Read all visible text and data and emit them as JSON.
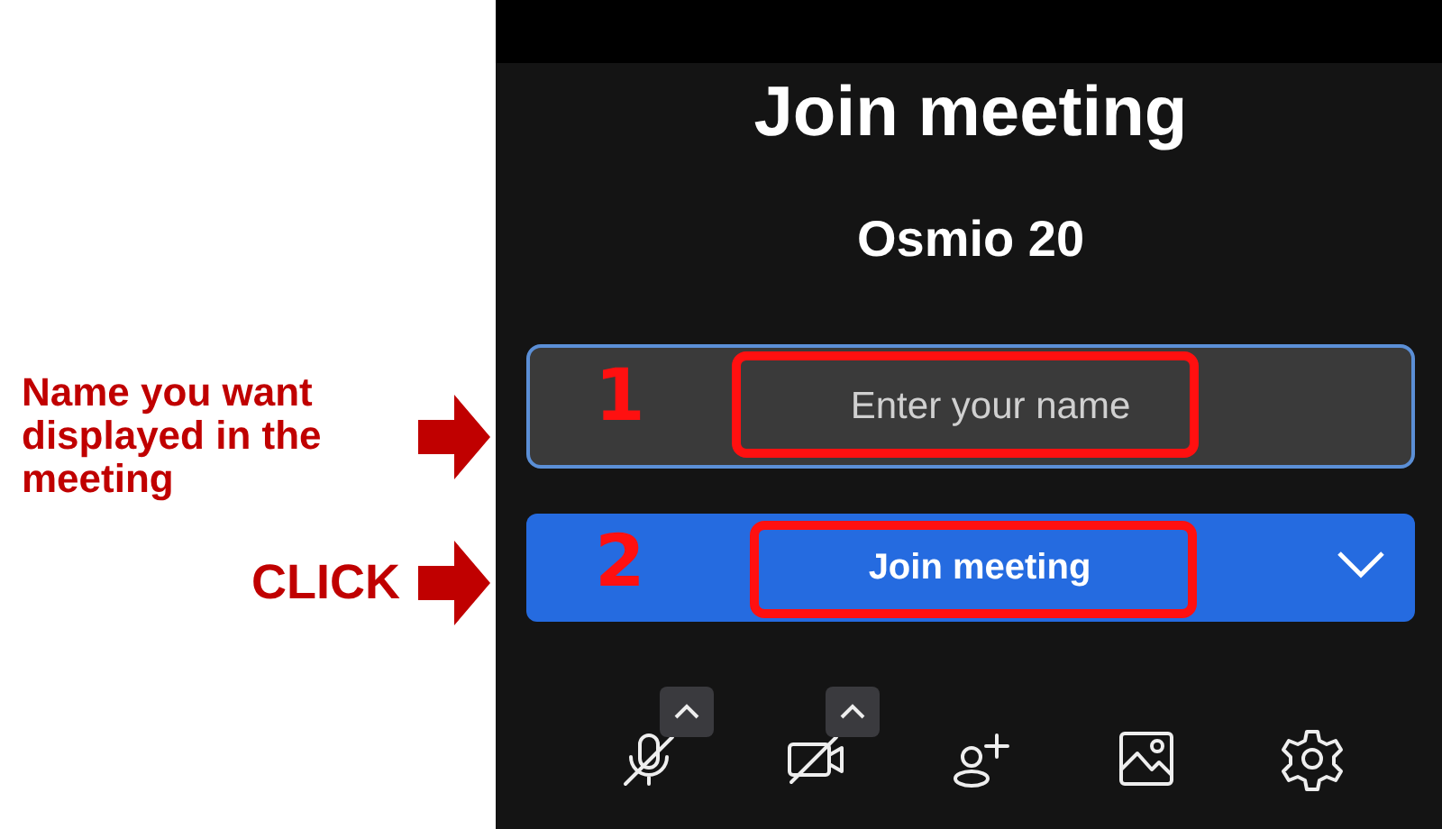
{
  "title": "Join meeting",
  "subtitle": "Osmio 20",
  "callouts": [
    {
      "text": "Name you want displayed in the meeting",
      "step": "1"
    },
    {
      "text": "CLICK",
      "step": "2"
    }
  ],
  "name_field": {
    "placeholder": "Enter your name"
  },
  "join_button": {
    "label": "Join meeting"
  },
  "toolbar": [
    {
      "kind": "mic-off",
      "has_menu": true
    },
    {
      "kind": "camera-off",
      "has_menu": true
    },
    {
      "kind": "person-add",
      "has_menu": false
    },
    {
      "kind": "image",
      "has_menu": false
    },
    {
      "kind": "settings",
      "has_menu": false
    }
  ]
}
